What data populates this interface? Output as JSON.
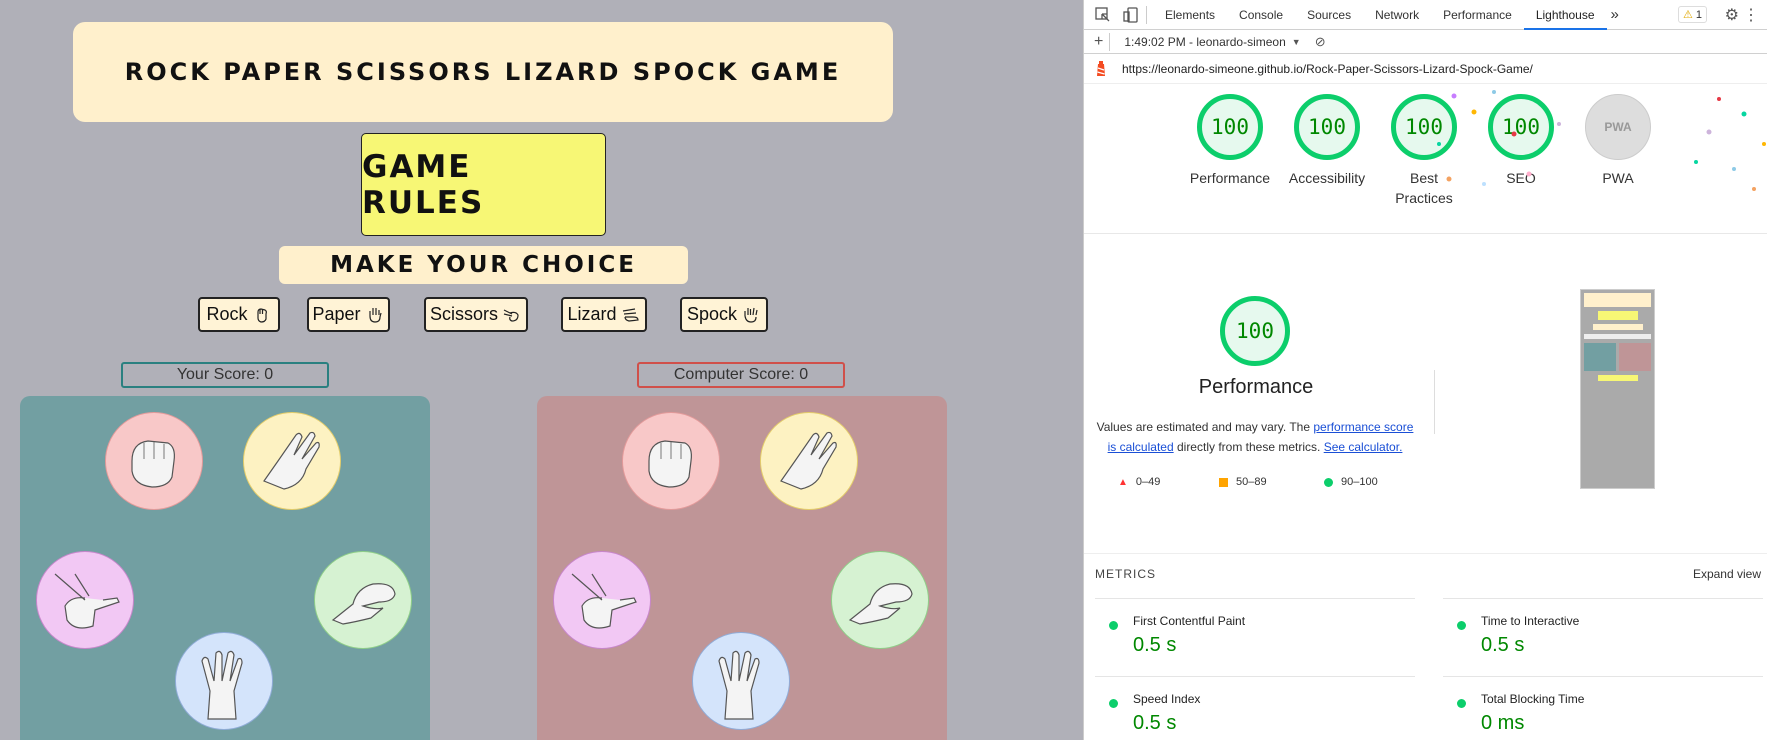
{
  "game": {
    "title": "ROCK PAPER SCISSORS LIZARD SPOCK GAME",
    "rules_button": "GAME RULES",
    "choice_heading": "MAKE YOUR CHOICE",
    "choices": [
      "Rock",
      "Paper",
      "Scissors",
      "Lizard",
      "Spock"
    ],
    "your_score": "Your Score: 0",
    "computer_score": "Computer Score: 0",
    "colors": {
      "page_bg": "#b0b0b8",
      "title_bg": "#fff0cc",
      "rules_bg": "#f7f775",
      "player_board": "#729fa2",
      "computer_board": "#bf9597"
    }
  },
  "devtools": {
    "tabs": [
      "Elements",
      "Console",
      "Sources",
      "Network",
      "Performance",
      "Lighthouse"
    ],
    "more": "»",
    "warnings": "1",
    "report_time": "1:49:02 PM - leonardo-simeon",
    "url": "https://leonardo-simeone.github.io/Rock-Paper-Scissors-Lizard-Spock-Game/",
    "scores": [
      {
        "label": "Performance",
        "value": "100"
      },
      {
        "label": "Accessibility",
        "value": "100"
      },
      {
        "label": "Best Practices",
        "value": "100"
      },
      {
        "label": "SEO",
        "value": "100"
      }
    ],
    "pwa_label": "PWA",
    "pwa_badge": "PWA",
    "performance": {
      "score": "100",
      "title": "Performance",
      "note_prefix": "Values are estimated and may vary. The ",
      "link1": "performance score is calculated",
      "note_middle": " directly from these metrics. ",
      "link2": "See calculator."
    },
    "legend": [
      "0–49",
      "50–89",
      "90–100"
    ],
    "metrics_heading": "METRICS",
    "expand_view": "Expand view",
    "metrics": [
      {
        "name": "First Contentful Paint",
        "value": "0.5 s"
      },
      {
        "name": "Time to Interactive",
        "value": "0.5 s"
      },
      {
        "name": "Speed Index",
        "value": "0.5 s"
      },
      {
        "name": "Total Blocking Time",
        "value": "0 ms"
      }
    ]
  }
}
